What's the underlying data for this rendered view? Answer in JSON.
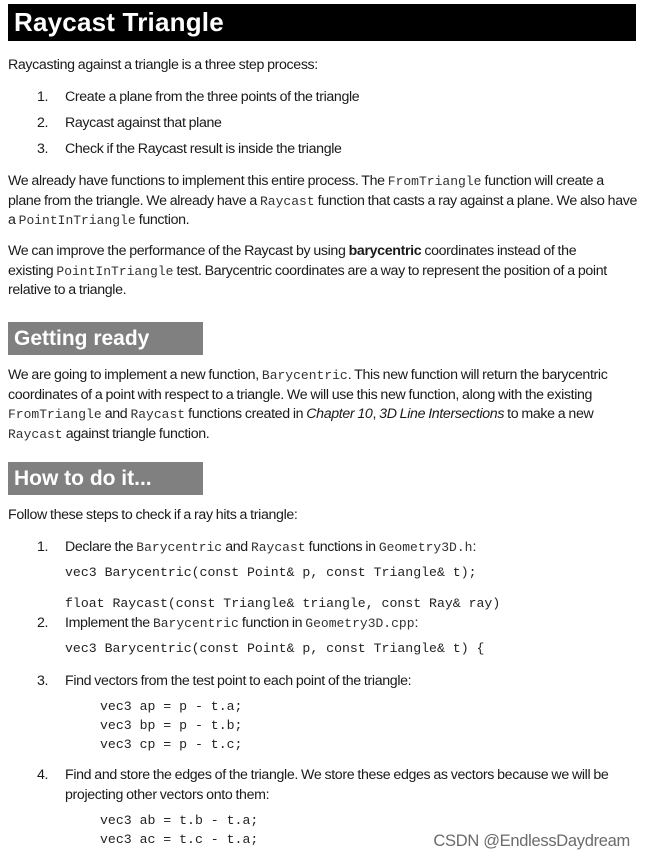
{
  "title": "Raycast Triangle",
  "intro": "Raycasting against a triangle is a three step process:",
  "steps_intro": [
    {
      "num": "1.",
      "text": "Create a plane from the three points of the triangle"
    },
    {
      "num": "2.",
      "text": "Raycast against that plane"
    },
    {
      "num": "3.",
      "text": "Check if the Raycast result is inside the triangle"
    }
  ],
  "para1": {
    "t1": "We already have functions to implement this entire process. The ",
    "c1": "FromTriangle",
    "t2": " function will create a plane from the triangle. We already have a ",
    "c2": "Raycast",
    "t3": " function that casts a ray against a plane. We also have a ",
    "c3": "PointInTriangle",
    "t4": " function."
  },
  "para2": {
    "t1": "We can improve the performance of the Raycast by using ",
    "b1": "barycentric",
    "t2": " coordinates instead of the existing ",
    "c1": "PointInTriangle",
    "t3": " test. Barycentric coordinates are a way to represent the position of a point relative to a triangle."
  },
  "section_getting_ready": {
    "heading": "Getting ready",
    "t1": "We are going to implement a new function, ",
    "c1": "Barycentric",
    "t2": ". This new function will return the barycentric coordinates of a point with respect to a triangle. We will use this new function, along with the existing ",
    "c2": "FromTriangle",
    "t3": " and ",
    "c3": "Raycast",
    "t4": " functions created in ",
    "i1": "Chapter 10",
    "t5": ", ",
    "i2": "3D Line Intersections",
    "t6": " to make a new ",
    "c4": "Raycast",
    "t7": " against triangle function."
  },
  "section_how_to": {
    "heading": "How to do it...",
    "intro": "Follow these steps to check if a ray hits a triangle:",
    "step1": {
      "num": "1.",
      "t1": "Declare the ",
      "c1": "Barycentric",
      "t2": " and ",
      "c2": "Raycast",
      "t3": " functions in ",
      "c3": "Geometry3D.h",
      "t4": ":",
      "code": [
        "vec3 Barycentric(const Point& p, const Triangle& t);",
        "float Raycast(const Triangle& triangle, const Ray& ray)"
      ]
    },
    "step2": {
      "num": "2.",
      "t1": "Implement the ",
      "c1": "Barycentric",
      "t2": " function in ",
      "c2": "Geometry3D.cpp",
      "t3": ":",
      "code": [
        "vec3 Barycentric(const Point& p, const Triangle& t) {"
      ]
    },
    "step3": {
      "num": "3.",
      "text": "Find vectors from the test point to each point of the triangle:",
      "code": [
        "vec3 ap = p - t.a;",
        "vec3 bp = p - t.b;",
        "vec3 cp = p - t.c;"
      ]
    },
    "step4": {
      "num": "4.",
      "text": "Find and store the edges of the triangle. We store these edges as vectors because we will be projecting other vectors onto them:",
      "code": [
        "vec3 ab = t.b - t.a;",
        "vec3 ac = t.c - t.a;"
      ]
    }
  },
  "watermark": "CSDN @EndlessDaydream"
}
